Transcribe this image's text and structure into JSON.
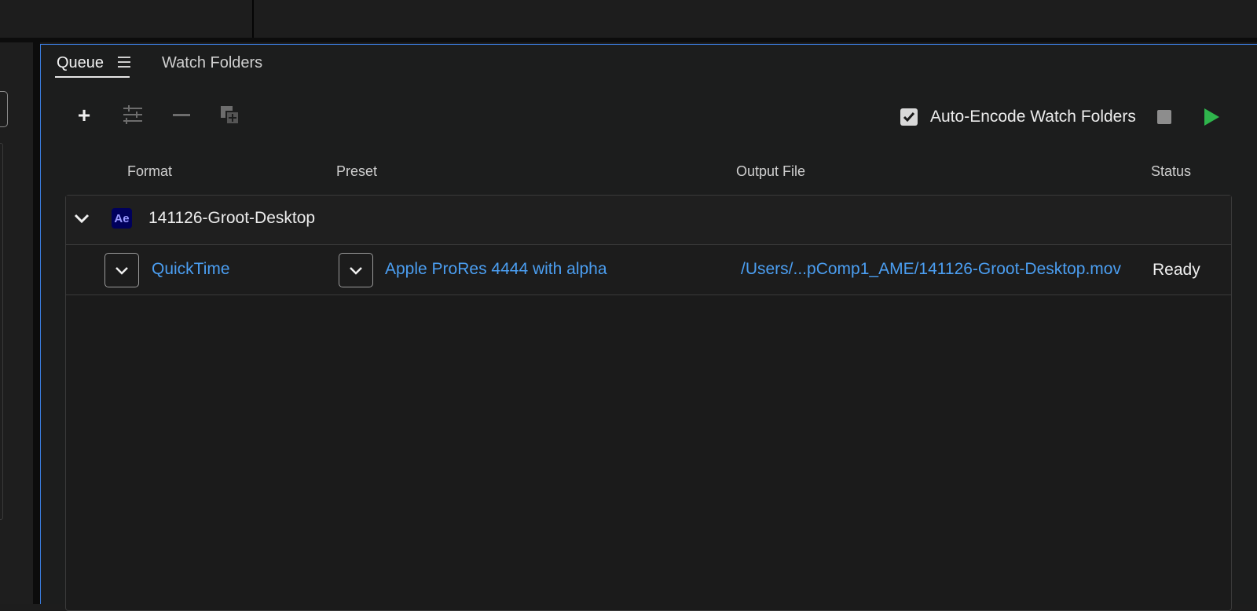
{
  "tabs": [
    {
      "label": "Queue",
      "active": true
    },
    {
      "label": "Watch Folders",
      "active": false
    }
  ],
  "toolbar": {
    "add_icon": "plus-icon",
    "settings_icon": "sliders-icon",
    "remove_icon": "minus-icon",
    "duplicate_icon": "duplicate-icon",
    "auto_encode": {
      "label": "Auto-Encode Watch Folders",
      "checked": true
    },
    "stop_icon": "stop-icon",
    "play_icon": "play-icon",
    "play_color": "#2fb54c"
  },
  "columns": {
    "format": "Format",
    "preset": "Preset",
    "output_file": "Output File",
    "status": "Status"
  },
  "queue": {
    "group": {
      "app_badge": "Ae",
      "name": "141126-Groot-Desktop",
      "expanded": true
    },
    "items": [
      {
        "format": "QuickTime",
        "preset": "Apple ProRes 4444 with alpha",
        "output_file": "/Users/...pComp1_AME/141126-Groot-Desktop.mov",
        "status": "Ready"
      }
    ]
  },
  "colors": {
    "accent_blue": "#3b7de0",
    "link_blue": "#4b9ef1",
    "ae_badge_bg": "#00005b",
    "ae_badge_text": "#9999ff"
  }
}
